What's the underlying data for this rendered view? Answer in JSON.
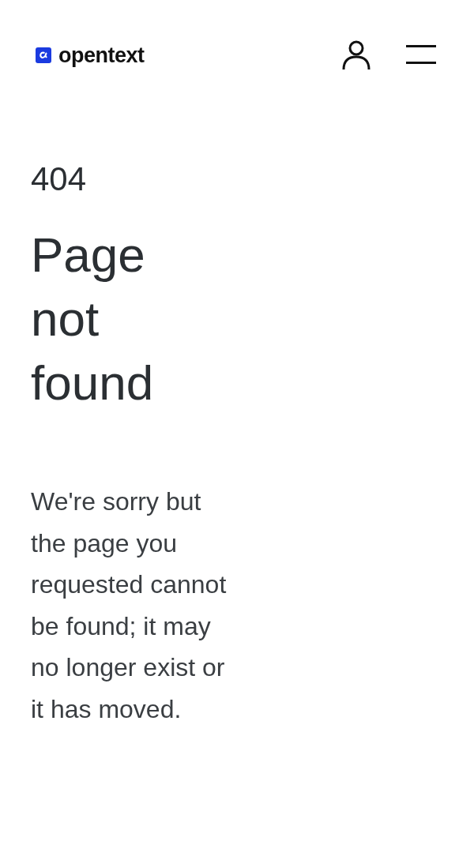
{
  "header": {
    "logo_text": "opentext"
  },
  "error": {
    "code": "404",
    "title": "Page not found",
    "message": "We're sorry but the page you requested cannot be found; it may no longer exist or it has moved."
  }
}
